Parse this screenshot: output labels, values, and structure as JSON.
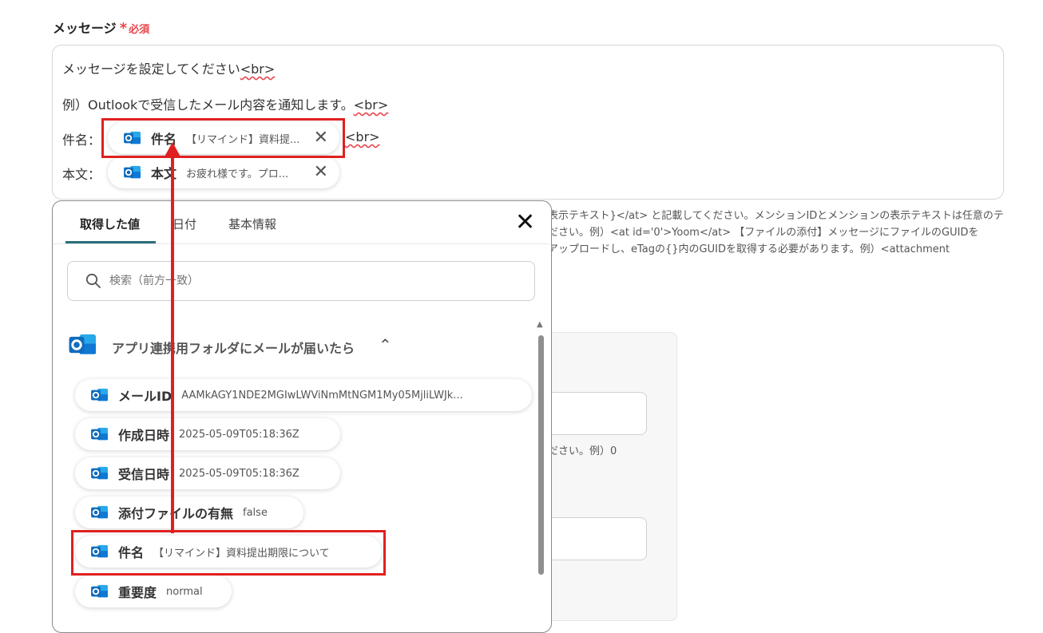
{
  "field": {
    "label": "メッセージ",
    "required_mark": "*",
    "required_text": "必須"
  },
  "editor": {
    "line1": "メッセージを設定してください",
    "line2": "例）Outlookで受信したメール内容を通知します。",
    "br_tag": "<br>",
    "subject_label": "件名：",
    "body_label": "本文：",
    "subject_pill": {
      "key": "件名",
      "value": "【リマインド】資料提..."
    },
    "body_pill": {
      "key": "本文",
      "value": "お疲れ様です。プロ..."
    }
  },
  "help_text": {
    "line1": "表示テキスト}</at> と記載してください。メンションIDとメンションの表示テキストは任意のテ",
    "line2": "ださい。例）<at id='0'>Yoom</at>  【ファイルの添付】メッセージにファイルのGUIDを",
    "line3": "アップロードし、eTagの{}内のGUIDを取得する必要があります。例）<attachment",
    "line4": "ださい。例）0"
  },
  "popup": {
    "tabs": [
      "取得した値",
      "日付",
      "基本情報"
    ],
    "search_placeholder": "検索（前方一致）",
    "section_title": "アプリ連携用フォルダにメールが届いたら",
    "items": [
      {
        "key": "メールID",
        "value": "AAMkAGY1NDE2MGIwLWViNmMtNGM1My05MjliLWJk..."
      },
      {
        "key": "作成日時",
        "value": "2025-05-09T05:18:36Z"
      },
      {
        "key": "受信日時",
        "value": "2025-05-09T05:18:36Z"
      },
      {
        "key": "添付ファイルの有無",
        "value": "false"
      },
      {
        "key": "件名",
        "value": "【リマインド】資料提出期限について"
      },
      {
        "key": "重要度",
        "value": "normal"
      }
    ]
  },
  "colors": {
    "required": "#e8464c",
    "tab_active": "#2a6f7b",
    "highlight": "#e02020",
    "outlook_blue": "#0f6cbd"
  }
}
